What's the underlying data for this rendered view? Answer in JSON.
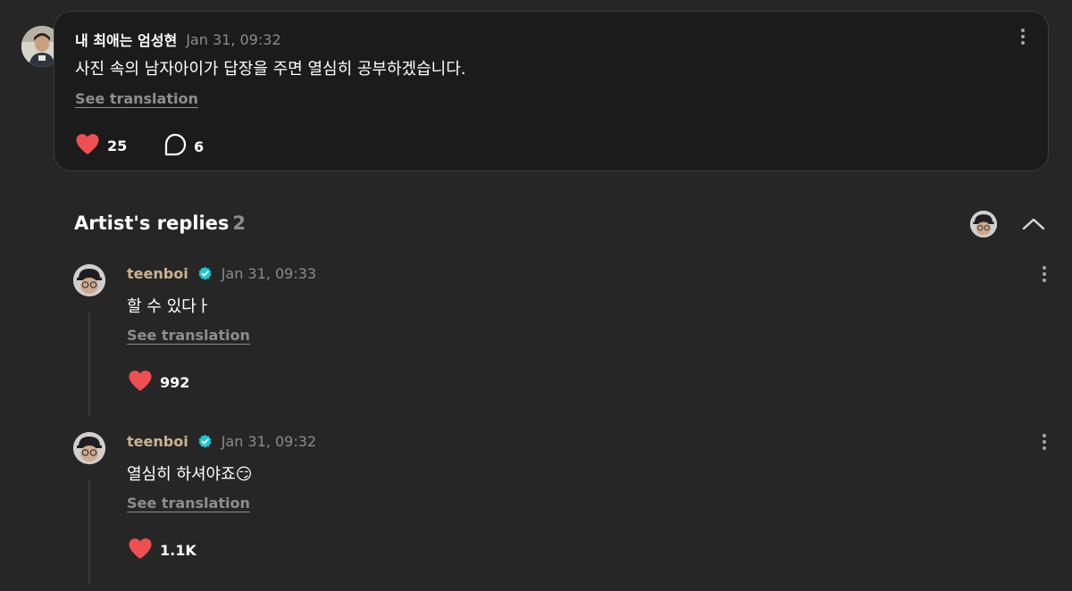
{
  "post": {
    "author": "내 최애는 엄성현",
    "time": "Jan 31, 09:32",
    "text": "사진 속의 남자아이가 답장을 주면 열심히 공부하겠습니다.",
    "see_translation": "See translation",
    "likes": "25",
    "comments": "6"
  },
  "artist_replies": {
    "title": "Artist's replies",
    "count": "2",
    "replies": [
      {
        "author": "teenboi",
        "time": "Jan 31, 09:33",
        "text": "할 수 있다ㅏ",
        "see_translation": "See translation",
        "likes": "992"
      },
      {
        "author": "teenboi",
        "time": "Jan 31, 09:32",
        "text": "열심히 하셔야죠😏",
        "see_translation": "See translation",
        "likes": "1.1K"
      }
    ]
  },
  "icons": {
    "heart": "heart-icon",
    "comment": "comment-bubble-icon",
    "more": "more-vertical-icon",
    "verified": "verified-badge-icon",
    "collapse": "chevron-up-icon"
  },
  "colors": {
    "background": "#262626",
    "card": "#1b1b1b",
    "heart": "#f04f52",
    "artist_name": "#cbb38f",
    "verified": "#1fc7d6",
    "muted": "#8b8b8b"
  }
}
